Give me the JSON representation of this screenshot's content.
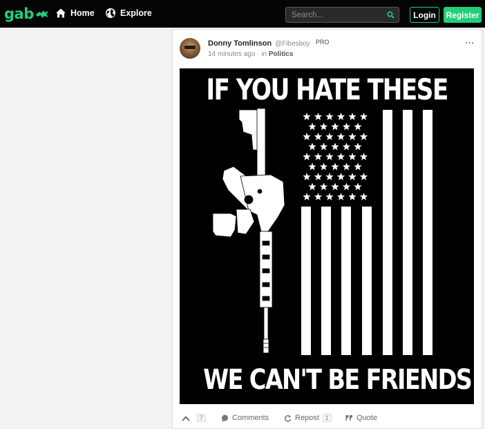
{
  "header": {
    "logo": "gab",
    "nav": [
      {
        "label": "Home",
        "icon": "home-icon"
      },
      {
        "label": "Explore",
        "icon": "globe-icon"
      }
    ],
    "search_placeholder": "Search...",
    "login_label": "Login",
    "register_label": "Register",
    "accent_color": "#21cf7a"
  },
  "post": {
    "author": {
      "display_name": "Donny Tomlinson",
      "username": "@Fibesboy",
      "badge": "PRO"
    },
    "time": "14 minutes ago",
    "in_label": "in",
    "group": "Politics",
    "more_label": "···",
    "image": {
      "top_text": "IF YOU HATE THESE",
      "bottom_text": "WE CAN'T BE FRIENDS"
    },
    "actions": {
      "upvote_count": "7",
      "comments_label": "Comments",
      "repost_label": "Repost",
      "repost_count": "1",
      "quote_label": "Quote"
    }
  }
}
